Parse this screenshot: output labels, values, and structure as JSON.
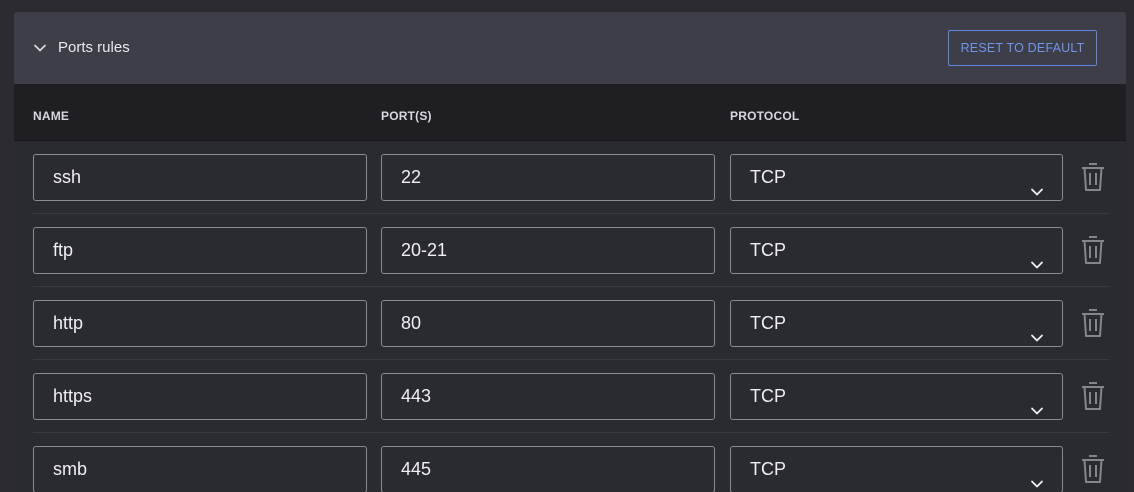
{
  "panel": {
    "title": "Ports rules",
    "reset_label": "RESET TO DEFAULT"
  },
  "columns": {
    "name": "NAME",
    "ports": "PORT(S)",
    "protocol": "PROTOCOL"
  },
  "rules": [
    {
      "name": "ssh",
      "ports": "22",
      "protocol": "TCP"
    },
    {
      "name": "ftp",
      "ports": "20-21",
      "protocol": "TCP"
    },
    {
      "name": "http",
      "ports": "80",
      "protocol": "TCP"
    },
    {
      "name": "https",
      "ports": "443",
      "protocol": "TCP"
    },
    {
      "name": "smb",
      "ports": "445",
      "protocol": "TCP"
    }
  ],
  "colors": {
    "accent": "#5d86de",
    "header_bg": "#3e3e48",
    "table_head_bg": "#1f1f23",
    "field_border": "#8a8a93",
    "trash_icon": "#85858d"
  },
  "icons": {
    "collapse": "chevron-down-icon",
    "select": "chevron-down-icon",
    "delete": "trash-icon"
  }
}
